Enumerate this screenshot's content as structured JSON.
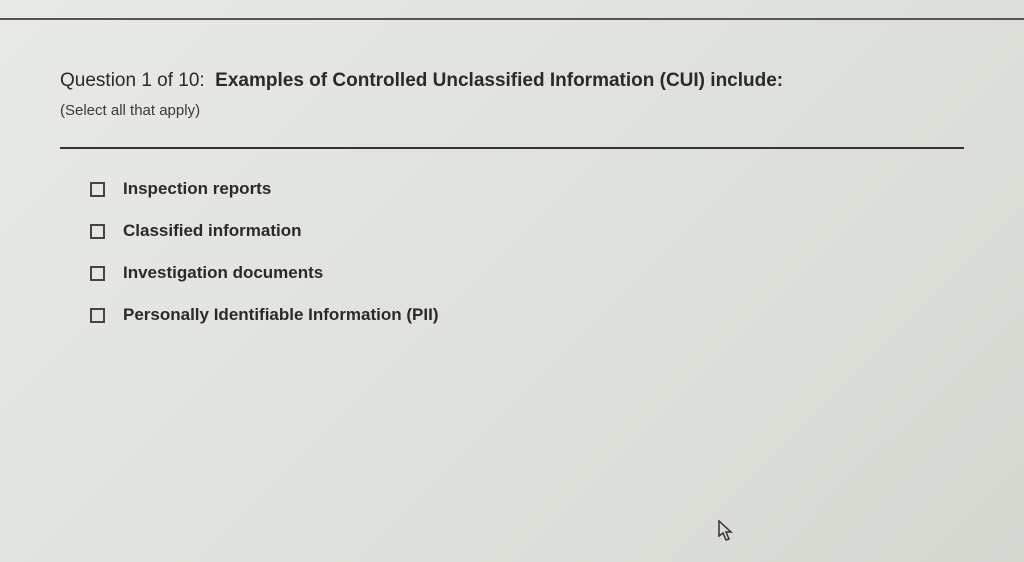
{
  "question": {
    "number_label": "Question 1 of 10:",
    "text": "Examples of Controlled Unclassified Information (CUI) include:",
    "instruction": "(Select all that apply)"
  },
  "options": [
    {
      "label": "Inspection reports",
      "checked": false
    },
    {
      "label": "Classified information",
      "checked": false
    },
    {
      "label": "Investigation documents",
      "checked": false
    },
    {
      "label": "Personally Identifiable Information (PII)",
      "checked": false
    }
  ]
}
